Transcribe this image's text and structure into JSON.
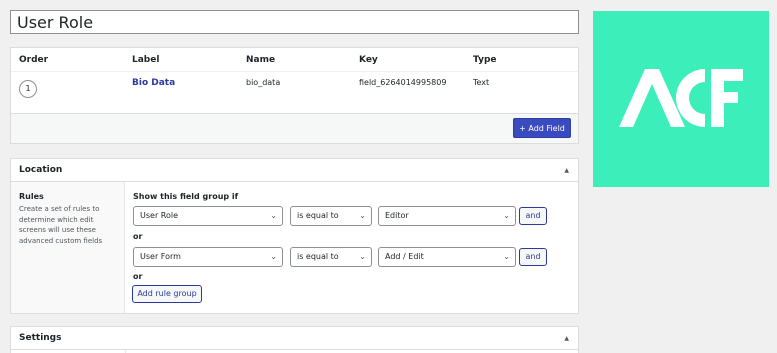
{
  "title_field": {
    "value": "User Role"
  },
  "fields_table": {
    "headers": {
      "order": "Order",
      "label": "Label",
      "name": "Name",
      "key": "Key",
      "type": "Type"
    },
    "rows": [
      {
        "order": "1",
        "label": "Bio Data",
        "name": "bio_data",
        "key": "field_6264014995809",
        "type": "Text"
      }
    ],
    "add_field_label": "+ Add Field"
  },
  "location": {
    "title": "Location",
    "rules_title": "Rules",
    "rules_description": "Create a set of rules to determine which edit screens will use these advanced custom fields",
    "show_if": "Show this field group if",
    "groups": [
      {
        "param": "User Role",
        "operator": "is equal to",
        "value": "Editor",
        "and_label": "and"
      },
      {
        "param": "User Form",
        "operator": "is equal to",
        "value": "Add / Edit",
        "and_label": "and"
      }
    ],
    "or_label": "or",
    "add_rule_group_label": "Add rule group"
  },
  "settings": {
    "title": "Settings"
  },
  "logo": {
    "text": "ACF",
    "background": "#3ceeb9"
  },
  "colors": {
    "accent": "#3a4bbf",
    "link": "#2c3aa0"
  }
}
